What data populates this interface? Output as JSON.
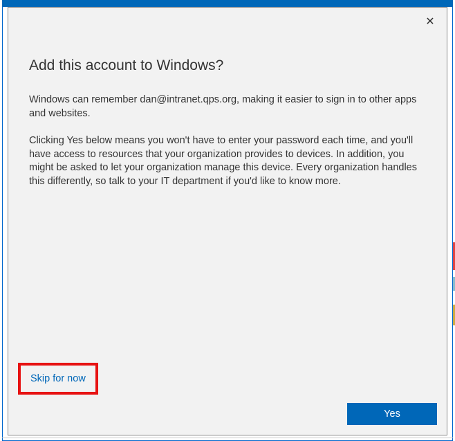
{
  "dialog": {
    "title": "Add this account to Windows?",
    "paragraph1": "Windows can remember dan@intranet.qps.org, making it easier to sign in to other apps and websites.",
    "paragraph2": "Clicking Yes below means you won't have to enter your password each time, and you'll have access to resources that your organization provides to devices. In addition, you might be asked to let your organization manage this device. Every organization handles this differently, so talk to your IT department if you'd like to know more.",
    "skip_label": "Skip for now",
    "yes_label": "Yes",
    "close_icon": "✕"
  }
}
